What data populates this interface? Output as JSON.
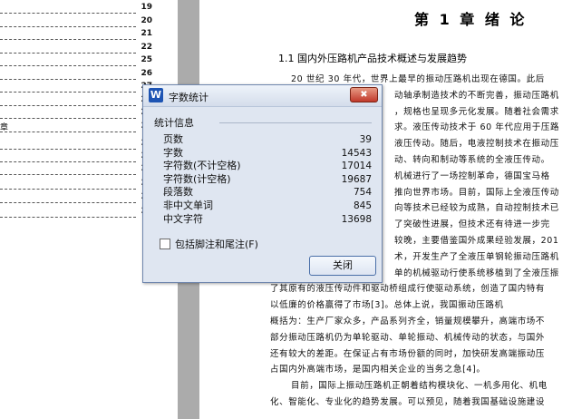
{
  "toc": {
    "page_numbers": [
      "19",
      "20",
      "21",
      "22",
      "25",
      "26",
      "27",
      "28",
      "29",
      "30",
      "31",
      "31",
      "32",
      "33",
      "34",
      "35"
    ],
    "fragment": "章"
  },
  "document": {
    "chapter_title": "第 1 章  绪  论",
    "section_title": "1.1  国内外压路机产品技术概述与发展趋势",
    "lines": [
      "20 世纪 30 年代，世界上最早的振动压路机出现在德国。此后",
      "动轴承制造技术的不断完善，振动压路机",
      "，规格也呈现多元化发展。随着社会需求",
      "求。液压传动技术于 60 年代应用于压路",
      "液压传动。随后，电液控制技术在振动压",
      "动、转向和制动等系统的全液压传动。",
      "机械进行了一场控制革命，德国宝马格",
      "推向世界市场。目前，国际上全液压传动",
      "向等技术已经较为成熟，自动控制技术已",
      "了突破性进展，但技术还有待进一步完",
      "较晚，主要借鉴国外成果经验发展，201",
      "术，开发生产了全液压单钢轮振动压路机",
      "单的机械驱动行使系统移植到了全液压振",
      "了其原有的液压传动件和驱动桥组成行使驱动系统，创造了国内特有",
      "以低廉的价格赢得了市场[3]。总体上说，我国振动压路机",
      "概括为：生产厂家众多，产品系列齐全，销量规模攀升，高端市场不",
      "部分振动压路机仍为单轮驱动、单轮振动、机械传动的状态，与国外",
      "还有较大的差距。在保证占有市场份额的同时，加快研发高端振动压",
      "占国内外高端市场，是国内相关企业的当务之急[4]。",
      "目前，国际上振动压路机正朝着结构模块化、一机多用化、机电",
      "化、智能化、专业化的趋势发展。可以预见，随着我国基础设施建设"
    ]
  },
  "dialog": {
    "title": "字数统计",
    "app_icon_letter": "W",
    "close_symbol": "✖",
    "group_label": "统计信息",
    "stats": [
      {
        "label": "页数",
        "value": "39"
      },
      {
        "label": "字数",
        "value": "14543"
      },
      {
        "label": "字符数(不计空格)",
        "value": "17014"
      },
      {
        "label": "字符数(计空格)",
        "value": "19687"
      },
      {
        "label": "段落数",
        "value": "754"
      },
      {
        "label": "非中文单词",
        "value": "845"
      },
      {
        "label": "中文字符",
        "value": "13698"
      }
    ],
    "checkbox_label": "包括脚注和尾注(F)",
    "checkbox_checked": false,
    "ok_label": "关闭"
  }
}
